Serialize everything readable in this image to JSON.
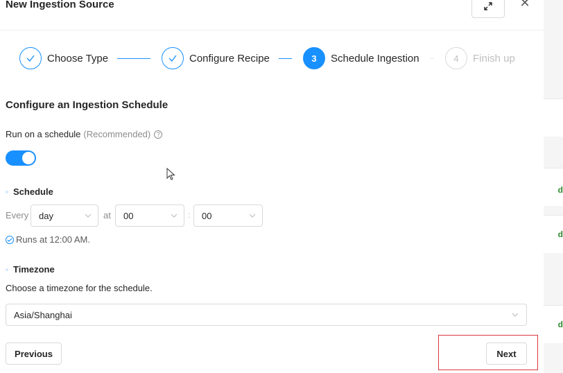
{
  "modal": {
    "title": "New Ingestion Source"
  },
  "steps": [
    {
      "label": "Choose Type",
      "status": "finish"
    },
    {
      "label": "Configure Recipe",
      "status": "finish"
    },
    {
      "label": "Schedule Ingestion",
      "status": "process",
      "number": "3"
    },
    {
      "label": "Finish up",
      "status": "wait",
      "number": "4"
    }
  ],
  "schedule": {
    "section_title": "Configure an Ingestion Schedule",
    "run_label": "Run on a schedule",
    "run_recommended": "(Recommended)",
    "toggle_on": true,
    "schedule_label": "Schedule",
    "every_label": "Every",
    "frequency_value": "day",
    "at_label": "at",
    "hour_value": "00",
    "colon": ":",
    "minute_value": "00",
    "runs_at_text": "Runs at 12:00 AM."
  },
  "timezone": {
    "label": "Timezone",
    "help": "Choose a timezone for the schedule.",
    "value": "Asia/Shanghai"
  },
  "footer": {
    "previous_label": "Previous",
    "next_label": "Next"
  },
  "colors": {
    "primary": "#1890ff",
    "highlight": "#d9363e"
  }
}
